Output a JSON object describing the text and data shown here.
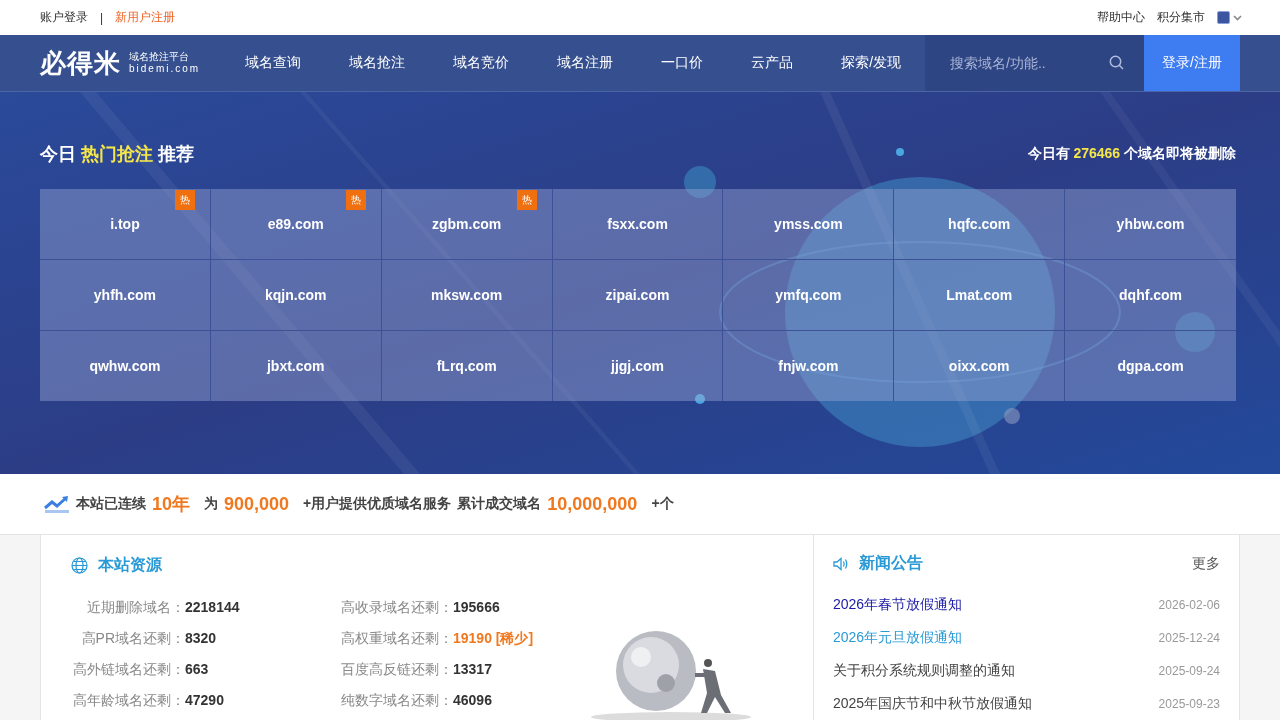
{
  "topbar": {
    "login": "账户登录",
    "separator": "|",
    "register": "新用户注册",
    "right_links": [
      "帮助中心",
      "积分集市"
    ]
  },
  "header": {
    "logo": "必得米",
    "logo_subtitle": "域名抢注平台",
    "logo_domain": "bidemi.com",
    "nav": [
      {
        "label": "域名查询"
      },
      {
        "label": "域名抢注"
      },
      {
        "label": "域名竞价"
      },
      {
        "label": "域名注册"
      },
      {
        "label": "一口价"
      },
      {
        "label": "云产品"
      },
      {
        "label": "探索/发现"
      }
    ],
    "search": {
      "placeholder": "搜索域名/功能.."
    },
    "login_button": "登录/注册"
  },
  "hot": {
    "title_prefix": "今日",
    "title_highlight": "热门抢注",
    "title_suffix": "推荐",
    "count_prefix": "今日有",
    "count": "276466",
    "count_suffix": "个域名即将被删除",
    "domains": [
      {
        "name": "i.top",
        "badge": "热"
      },
      {
        "name": "e89.com",
        "badge": "热"
      },
      {
        "name": "zgbm.com",
        "badge": "热"
      },
      {
        "name": "fsxx.com"
      },
      {
        "name": "ymss.com"
      },
      {
        "name": "hqfc.com"
      },
      {
        "name": "yhbw.com"
      },
      {
        "name": "yhfh.com"
      },
      {
        "name": "kqjn.com"
      },
      {
        "name": "mksw.com"
      },
      {
        "name": "zipai.com"
      },
      {
        "name": "ymfq.com"
      },
      {
        "name": "Lmat.com"
      },
      {
        "name": "dqhf.com"
      },
      {
        "name": "qwhw.com"
      },
      {
        "name": "jbxt.com"
      },
      {
        "name": "fLrq.com"
      },
      {
        "name": "jjgj.com"
      },
      {
        "name": "fnjw.com"
      },
      {
        "name": "oixx.com"
      },
      {
        "name": "dgpa.com"
      }
    ]
  },
  "stats": [
    {
      "text": "本站已连续",
      "value": "10年"
    },
    {
      "text": "为",
      "value": "900,000"
    },
    {
      "text": "+用户提供优质域名服务"
    },
    {
      "text": "累计成交域名",
      "value": "10,000,000"
    },
    {
      "text": "+个"
    }
  ],
  "resources": {
    "title": "本站资源",
    "items": [
      {
        "label": "近期删除域名：",
        "value": "2218144",
        "highlight": false
      },
      {
        "label": "高收录域名还剩：",
        "value": "195666",
        "highlight": false
      },
      {
        "label": "高PR域名还剩：",
        "value": "8320",
        "highlight": false
      },
      {
        "label": "高权重域名还剩：",
        "value": "19190 [稀少]",
        "highlight": true
      },
      {
        "label": "高外链域名还剩：",
        "value": "663",
        "highlight": false
      },
      {
        "label": "百度高反链还剩：",
        "value": "13317",
        "highlight": false
      },
      {
        "label": "高年龄域名还剩：",
        "value": "47290",
        "highlight": false
      },
      {
        "label": "纯数字域名还剩：",
        "value": "46096",
        "highlight": false
      }
    ]
  },
  "news": {
    "title": "新闻公告",
    "more": "更多",
    "items": [
      {
        "title": "2026年春节放假通知",
        "date": "2026-02-06",
        "color": "#1a1aa6"
      },
      {
        "title": "2026年元旦放假通知",
        "date": "2025-12-24",
        "color": "#2a9ad6"
      },
      {
        "title": "关于积分系统规则调整的通知",
        "date": "2025-09-24",
        "color": "#444444"
      },
      {
        "title": "2025年国庆节和中秋节放假通知",
        "date": "2025-09-23",
        "color": "#444444"
      }
    ]
  }
}
